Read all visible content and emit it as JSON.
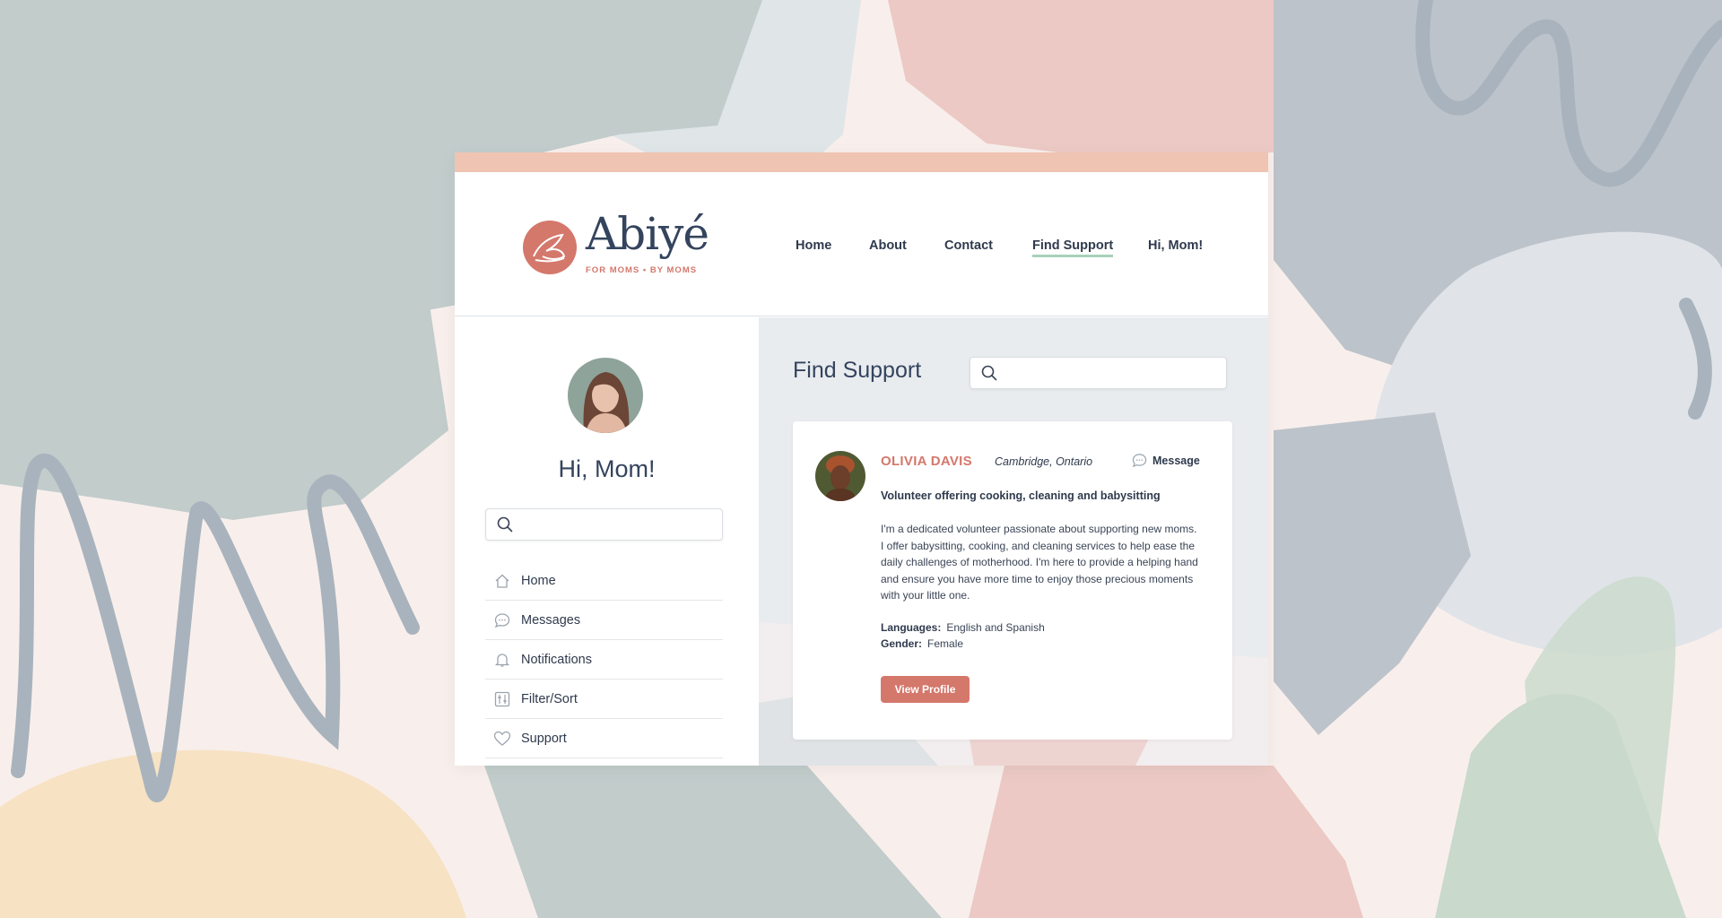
{
  "brand": {
    "name": "Abiyé",
    "tagline": "FOR MOMS • BY MOMS"
  },
  "nav": {
    "home": "Home",
    "about": "About",
    "contact": "Contact",
    "find_support": "Find Support",
    "hi_mom": "Hi, Mom!"
  },
  "sidebar": {
    "greeting": "Hi, Mom!",
    "search_placeholder": "",
    "items": [
      {
        "label": "Home",
        "icon": "home-icon"
      },
      {
        "label": "Messages",
        "icon": "chat-bubble-icon"
      },
      {
        "label": "Notifications",
        "icon": "bell-icon"
      },
      {
        "label": "Filter/Sort",
        "icon": "filter-icon"
      },
      {
        "label": "Support",
        "icon": "heart-icon"
      }
    ]
  },
  "main": {
    "title": "Find Support",
    "search_placeholder": "",
    "result": {
      "name": "OLIVIA DAVIS",
      "location": "Cambridge, Ontario",
      "message_label": "Message",
      "headline": "Volunteer offering cooking, cleaning and babysitting",
      "bio": "I'm a dedicated volunteer passionate about supporting new moms. I offer babysitting, cooking, and cleaning services to help ease the daily challenges of motherhood. I'm here to provide a helping hand and ensure you have more time to enjoy those precious moments with your little one.",
      "languages_label": "Languages:",
      "languages": "English and Spanish",
      "gender_label": "Gender:",
      "gender": "Female",
      "view_profile": "View Profile"
    }
  },
  "colors": {
    "accent": "#d4786c",
    "topbar": "#efc4b2",
    "nav_underline": "#a8d1ba",
    "text": "#2f3a4d"
  }
}
